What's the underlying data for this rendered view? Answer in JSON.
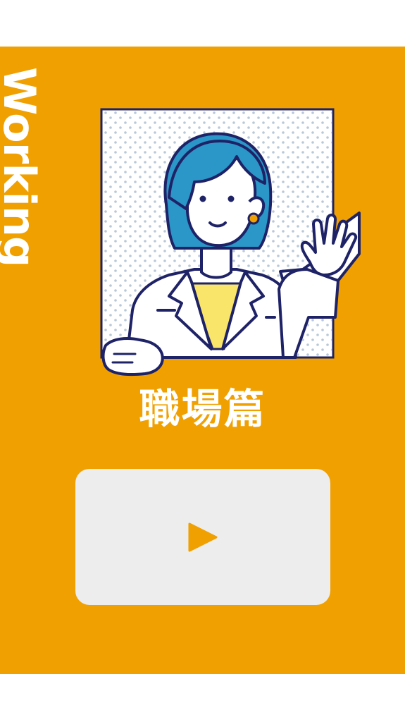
{
  "vertical_text": "Working",
  "title": "職場篇",
  "video": {
    "play_icon": "play-icon"
  },
  "colors": {
    "card_background": "#F0A000",
    "video_box": "#EDEDED",
    "play_icon": "#F0A000",
    "text": "#FFFFFF"
  }
}
